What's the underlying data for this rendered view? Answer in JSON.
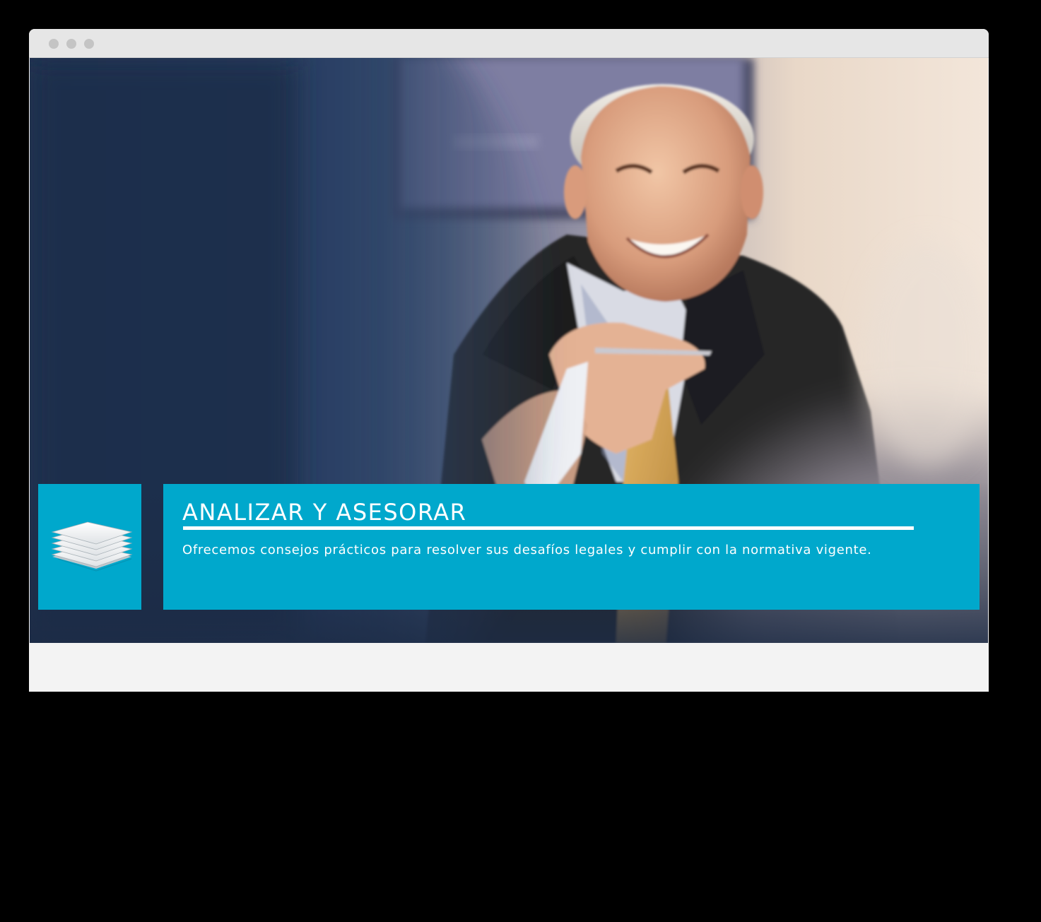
{
  "window": {
    "controls": [
      "close-dot",
      "minimize-dot",
      "maximize-dot"
    ]
  },
  "hero": {
    "image": "smiling-businessman-holding-pen-photo",
    "icon": "stacked-papers-icon",
    "title": "ANALIZAR Y ASESORAR",
    "description": "Ofrecemos consejos prácticos para resolver sus desafíos legales y cumplir con la normativa vigente."
  },
  "colors": {
    "accent": "#00a8cc",
    "titlebar": "#e6e6e6",
    "page_background": "#f3f3f3",
    "outer_background": "#000000"
  }
}
